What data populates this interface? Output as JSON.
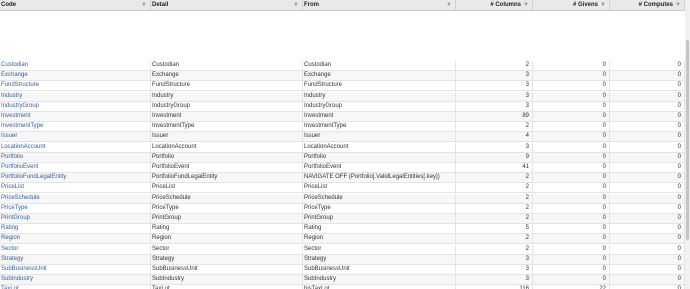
{
  "columns": {
    "code": "Code",
    "detail": "Detail",
    "from": "From",
    "columns_count": "# Columns",
    "givens": "# Givens",
    "computes": "# Computes"
  },
  "rows": [
    {
      "code": "Custodian",
      "detail": "Custodian",
      "from": "Custodian",
      "cols": "2",
      "givens": "0",
      "computes": "0"
    },
    {
      "code": "Exchange",
      "detail": "Exchange",
      "from": "Exchange",
      "cols": "3",
      "givens": "0",
      "computes": "0"
    },
    {
      "code": "FundStructure",
      "detail": "FundStructure",
      "from": "FundStructure",
      "cols": "3",
      "givens": "0",
      "computes": "0"
    },
    {
      "code": "Industry",
      "detail": "Industry",
      "from": "Industry",
      "cols": "3",
      "givens": "0",
      "computes": "0"
    },
    {
      "code": "IndustryGroup",
      "detail": "IndustryGroup",
      "from": "IndustryGroup",
      "cols": "3",
      "givens": "0",
      "computes": "0"
    },
    {
      "code": "Investment",
      "detail": "Investment",
      "from": "Investment",
      "cols": "89",
      "givens": "0",
      "computes": "0"
    },
    {
      "code": "InvestmentType",
      "detail": "InvestmentType",
      "from": "InvestmentType",
      "cols": "2",
      "givens": "0",
      "computes": "0"
    },
    {
      "code": "Issuer",
      "detail": "Issuer",
      "from": "Issuer",
      "cols": "4",
      "givens": "0",
      "computes": "0"
    },
    {
      "code": "LocationAccount",
      "detail": "LocationAccount",
      "from": "LocationAccount",
      "cols": "3",
      "givens": "0",
      "computes": "0"
    },
    {
      "code": "Portfolio",
      "detail": "Portfolio",
      "from": "Portfolio",
      "cols": "9",
      "givens": "0",
      "computes": "0"
    },
    {
      "code": "PortfolioEvent",
      "detail": "PortfolioEvent",
      "from": "PortfolioEvent",
      "cols": "41",
      "givens": "0",
      "computes": "0"
    },
    {
      "code": "PortfolioFundLegalEntity",
      "detail": "PortfolioFundLegalEntity",
      "from": "NAVIGATE OFF (Portfolio[.ValidLegalEntities[.key])",
      "cols": "2",
      "givens": "0",
      "computes": "0"
    },
    {
      "code": "PriceList",
      "detail": "PriceList",
      "from": "PriceList",
      "cols": "2",
      "givens": "0",
      "computes": "0"
    },
    {
      "code": "PriceSchedule",
      "detail": "PriceSchedule",
      "from": "PriceSchedule",
      "cols": "2",
      "givens": "0",
      "computes": "0"
    },
    {
      "code": "PriceType",
      "detail": "PriceType",
      "from": "PriceType",
      "cols": "2",
      "givens": "0",
      "computes": "0"
    },
    {
      "code": "PrintGroup",
      "detail": "PrintGroup",
      "from": "PrintGroup",
      "cols": "2",
      "givens": "0",
      "computes": "0"
    },
    {
      "code": "Rating",
      "detail": "Rating",
      "from": "Rating",
      "cols": "5",
      "givens": "0",
      "computes": "0"
    },
    {
      "code": "Region",
      "detail": "Region",
      "from": "Region",
      "cols": "2",
      "givens": "0",
      "computes": "0"
    },
    {
      "code": "Sector",
      "detail": "Sector",
      "from": "Sector",
      "cols": "2",
      "givens": "0",
      "computes": "0"
    },
    {
      "code": "Strategy",
      "detail": "Strategy",
      "from": "Strategy",
      "cols": "3",
      "givens": "0",
      "computes": "0"
    },
    {
      "code": "SubBusinessUnit",
      "detail": "SubBusinessUnit",
      "from": "SubBusinessUnit",
      "cols": "3",
      "givens": "0",
      "computes": "0"
    },
    {
      "code": "SubIndustry",
      "detail": "SubIndustry",
      "from": "SubIndustry",
      "cols": "3",
      "givens": "0",
      "computes": "0"
    },
    {
      "code": "TaxLot",
      "detail": "TaxLot",
      "from": "hisTaxLot",
      "cols": "116",
      "givens": "22",
      "computes": "0"
    }
  ]
}
